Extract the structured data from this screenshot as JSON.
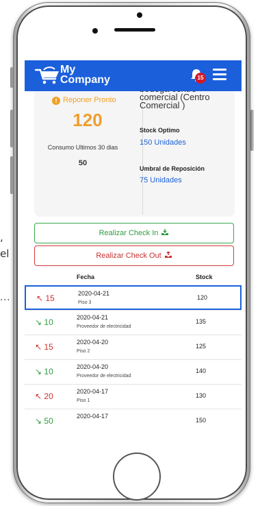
{
  "background_text": {
    "line1": ",",
    "line2": "el",
    "dots": "..."
  },
  "header": {
    "brand_line1": "My",
    "brand_line2": "Company",
    "notification_count": "15"
  },
  "stats": {
    "alert_label": "Reponer Pronto",
    "alert_icon": "!",
    "stock_value": "120",
    "consumption_label": "Consumo Ultimos 30 dias",
    "consumption_value": "50",
    "location": "bodega centro comercial (Centro Comercial )",
    "optimal_label": "Stock Optimo",
    "optimal_value": "150 Unidades",
    "threshold_label": "Umbral de Reposición",
    "threshold_value": "75 Unidades"
  },
  "actions": {
    "check_in": "Realizar Check In",
    "check_out": "Realizar Check Out"
  },
  "table": {
    "headers": {
      "fecha": "Fecha",
      "stock": "Stock"
    },
    "rows": [
      {
        "qty": "15",
        "direction": "out",
        "arrow": "↖",
        "date": "2020-04-21",
        "desc": "Piso 3",
        "stock": "120",
        "selected": true
      },
      {
        "qty": "10",
        "direction": "in",
        "arrow": "↘",
        "date": "2020-04-21",
        "desc": "Proveedor de electricidad",
        "stock": "135"
      },
      {
        "qty": "15",
        "direction": "out",
        "arrow": "↖",
        "date": "2020-04-20",
        "desc": "Piso 2",
        "stock": "125"
      },
      {
        "qty": "10",
        "direction": "in",
        "arrow": "↘",
        "date": "2020-04-20",
        "desc": "Proveedor de electricidad",
        "stock": "140"
      },
      {
        "qty": "20",
        "direction": "out",
        "arrow": "↖",
        "date": "2020-04-17",
        "desc": "Piso 1",
        "stock": "130"
      },
      {
        "qty": "50",
        "direction": "in",
        "arrow": "↘",
        "date": "2020-04-17",
        "desc": "",
        "stock": "150"
      }
    ]
  },
  "colors": {
    "appbar": "#1b5fdb",
    "warning": "#f0a024",
    "link": "#1d62d6",
    "check_in": "#2d9c42",
    "check_out": "#c72f2f",
    "badge": "#d11a2a"
  }
}
